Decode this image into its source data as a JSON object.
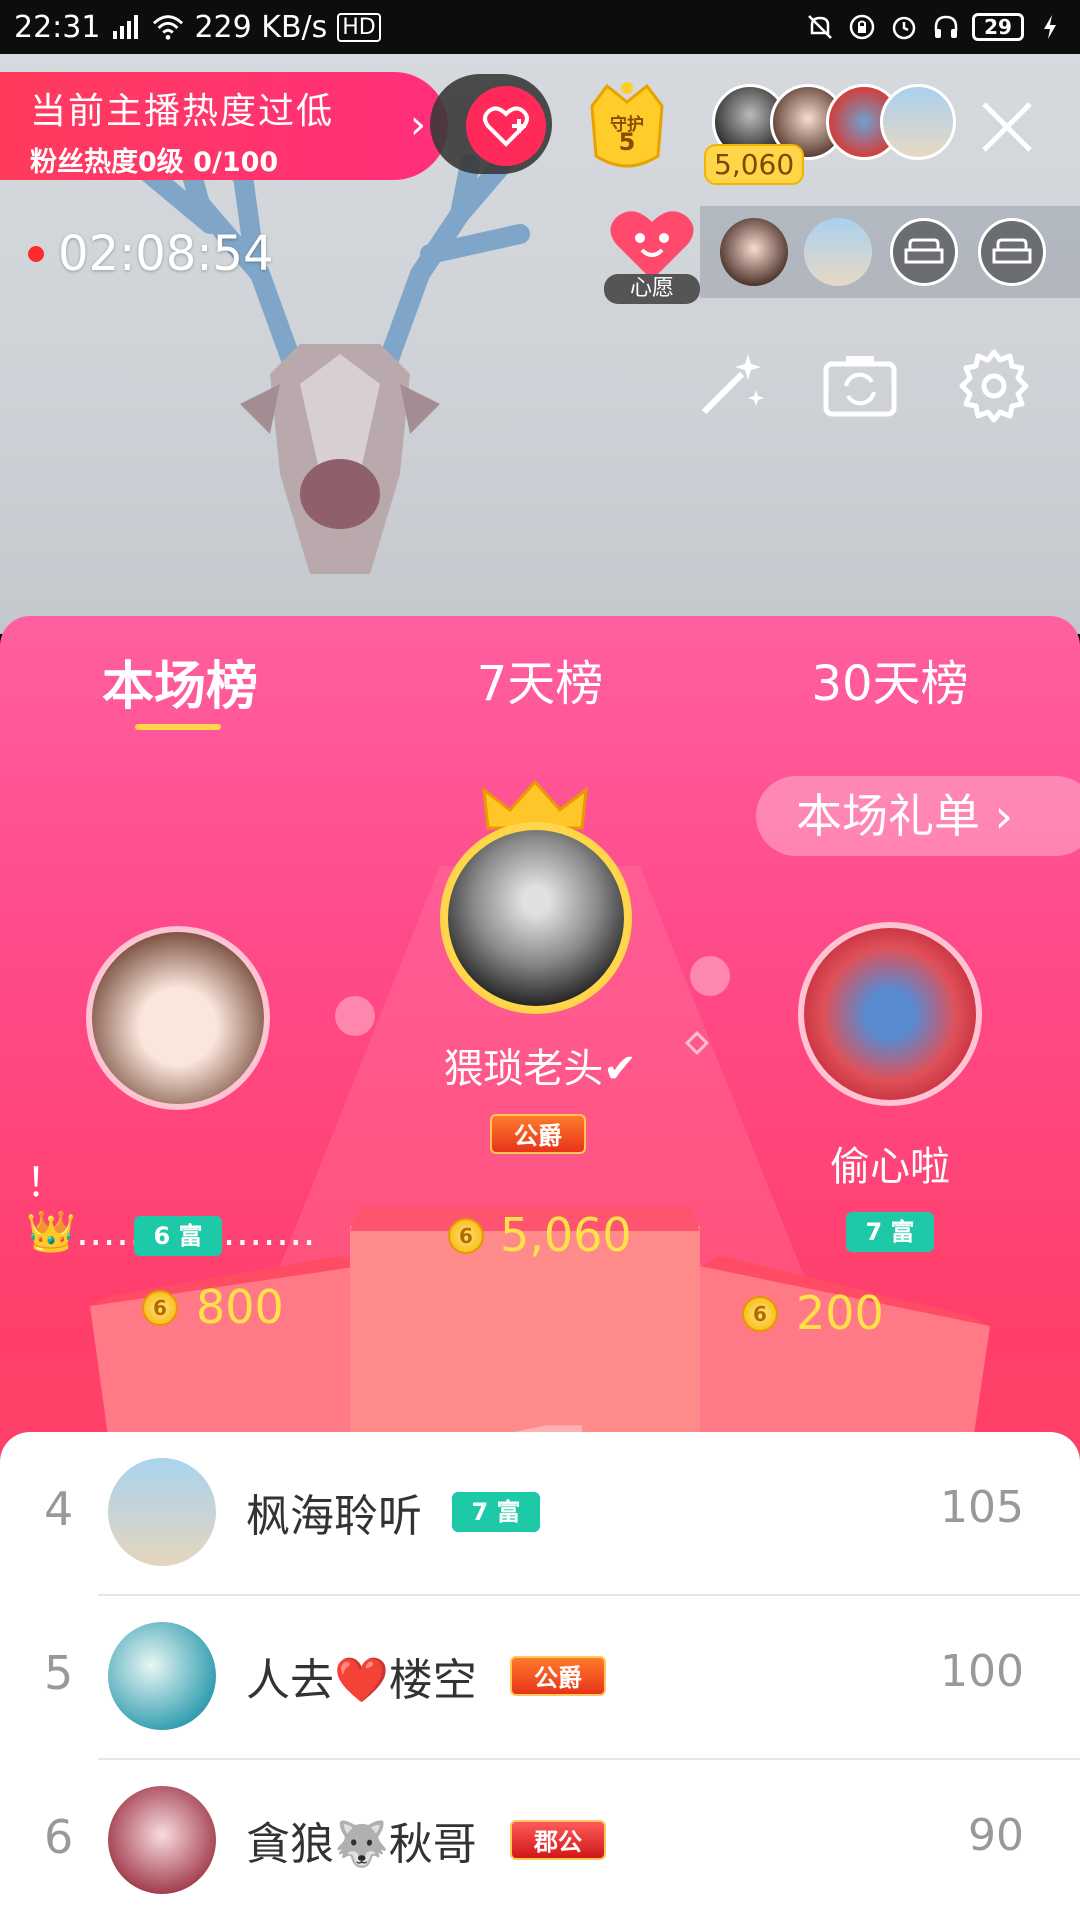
{
  "status_bar": {
    "time": "22:31",
    "network": "4G",
    "speed": "229 KB/s",
    "hd": "HD",
    "battery": "29"
  },
  "live": {
    "heat_title": "当前主播热度过低",
    "heat_sub": "粉丝热度0级 0/100",
    "guard_label": "守护",
    "guard_count": "5",
    "audience_count": "5,060",
    "timer": "02:08:54",
    "wish_label": "心愿"
  },
  "tabs": [
    "本场榜",
    "7天榜",
    "30天榜"
  ],
  "gift_list_label": "本场礼单 ›",
  "podium": {
    "first": {
      "name": "猥琐老头✔",
      "badge": "公爵",
      "score": "5,060",
      "rank": "1"
    },
    "second": {
      "name": "！ 👑………………",
      "badge": "6 富",
      "score": "800",
      "rank": "2"
    },
    "third": {
      "name": "偷心啦",
      "badge": "7 富",
      "score": "200",
      "rank": "3"
    }
  },
  "list": [
    {
      "rank": "4",
      "name": "枫海聆听",
      "badge": "7 富",
      "badge_type": "rich",
      "score": "105"
    },
    {
      "rank": "5",
      "name": "人去❤️楼空",
      "badge": "公爵",
      "badge_type": "duke",
      "score": "100"
    },
    {
      "rank": "6",
      "name": "貪狼🐺秋哥",
      "badge": "郡公",
      "badge_type": "county",
      "score": "90"
    }
  ],
  "colors": {
    "accent": "#ff3f6a",
    "gold": "#ffe14a",
    "rich_badge": "#1dc9a6"
  }
}
